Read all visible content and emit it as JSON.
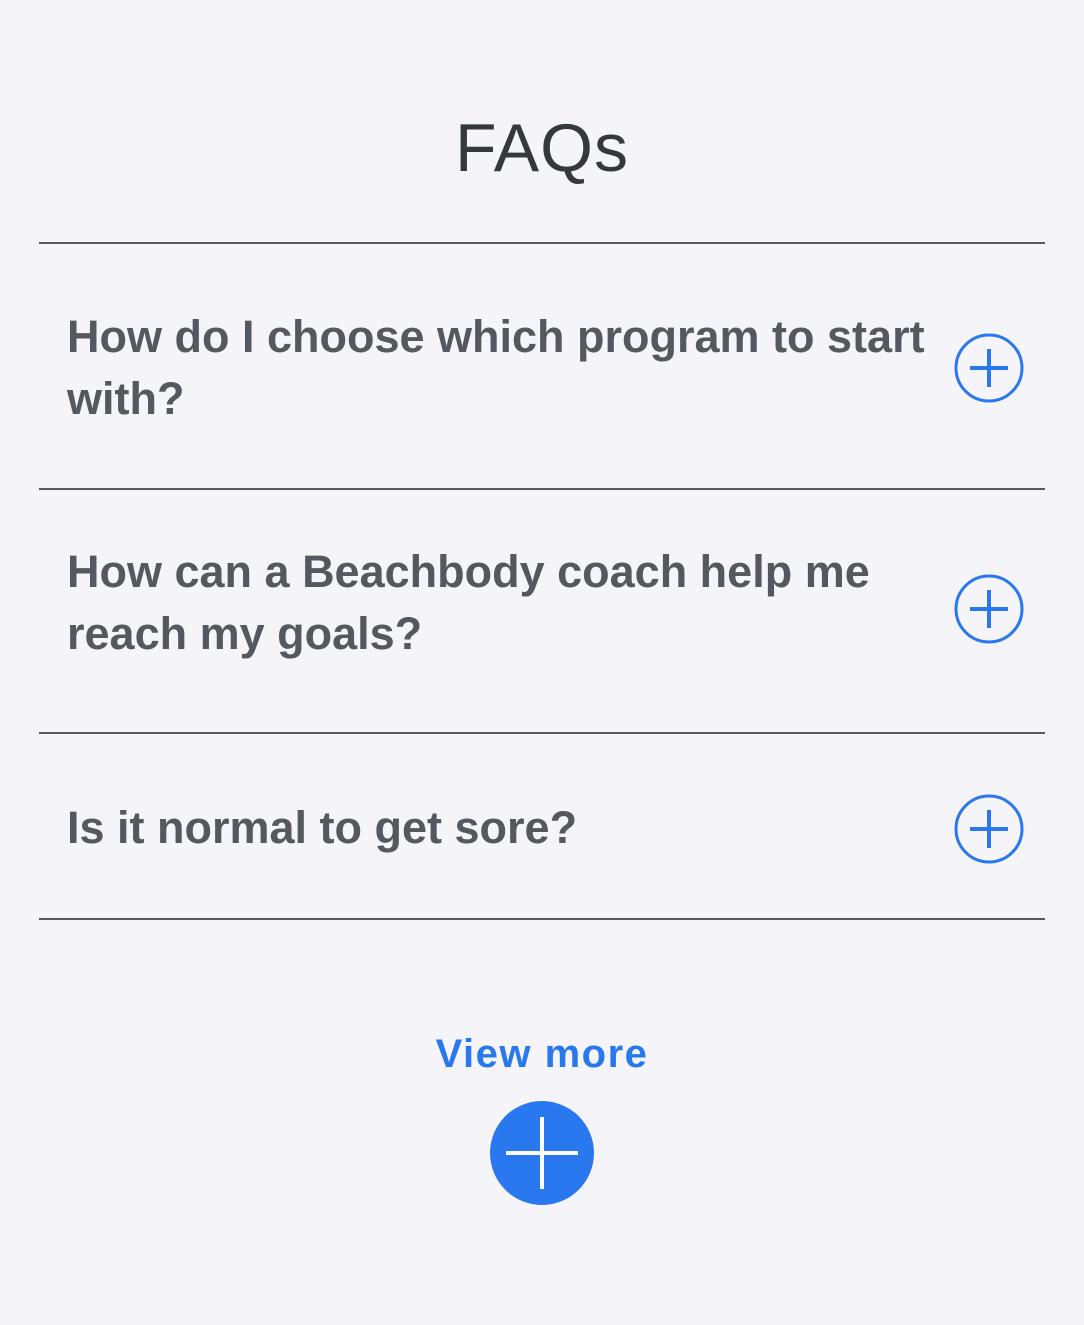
{
  "page": {
    "title": "FAQs"
  },
  "faq": {
    "items": [
      {
        "question": "How do I choose which program to start with?",
        "expanded": false,
        "icon": "plus-circle-icon"
      },
      {
        "question": "How can a Beachbody coach help me reach my goals?",
        "expanded": false,
        "icon": "plus-circle-icon"
      },
      {
        "question": "Is it normal to get sore?",
        "expanded": false,
        "icon": "plus-circle-icon"
      }
    ]
  },
  "view_more": {
    "label": "View more",
    "icon": "plus-filled-circle-icon"
  },
  "colors": {
    "background": "#f5f5f9",
    "title_text": "#35383d",
    "question_text": "#55585e",
    "divider": "#55585e",
    "accent_blue": "#2a78ef"
  }
}
